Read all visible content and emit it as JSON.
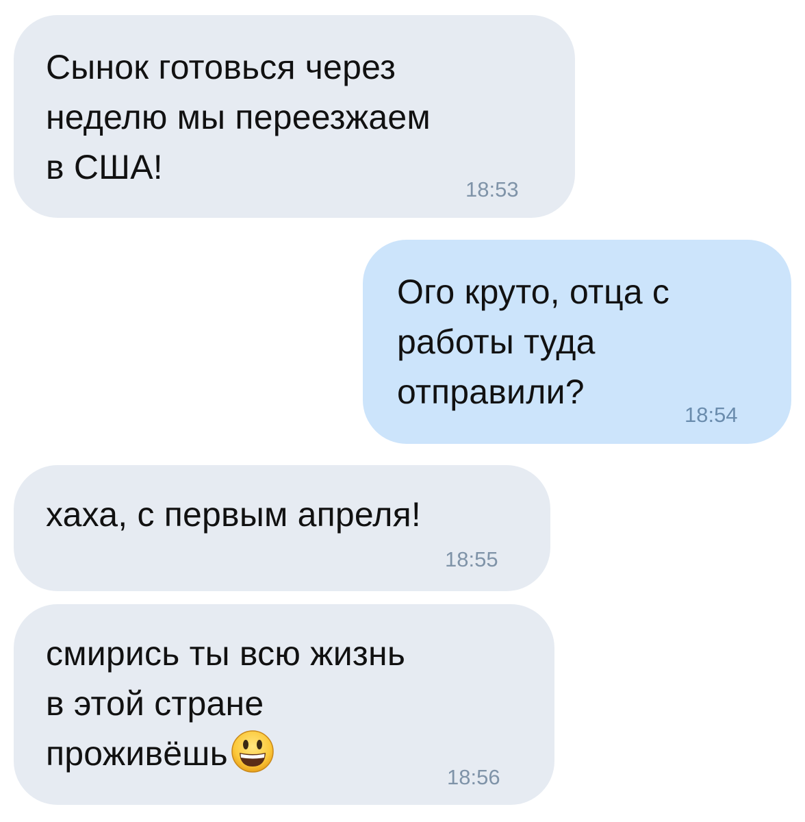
{
  "chat": {
    "messages": [
      {
        "direction": "incoming",
        "lines": [
          "Сынок готовься через",
          "неделю мы переезжаем",
          "в США!"
        ],
        "time": "18:53"
      },
      {
        "direction": "outgoing",
        "lines": [
          "Ого круто, отца с",
          "работы туда",
          "отправили?"
        ],
        "time": "18:54"
      },
      {
        "direction": "incoming",
        "lines": [
          "хаха, с первым апреля!"
        ],
        "time": "18:55"
      },
      {
        "direction": "incoming",
        "lines": [
          "смирись ты всю жизнь",
          "в этой стране",
          "проживёшь"
        ],
        "emoji": "grinning-face-emoji",
        "time": "18:56"
      }
    ]
  },
  "colors": {
    "incoming_bubble": "#e6ebf2",
    "outgoing_bubble": "#cce4fb",
    "text": "#111111",
    "timestamp": "#7f93a8"
  }
}
